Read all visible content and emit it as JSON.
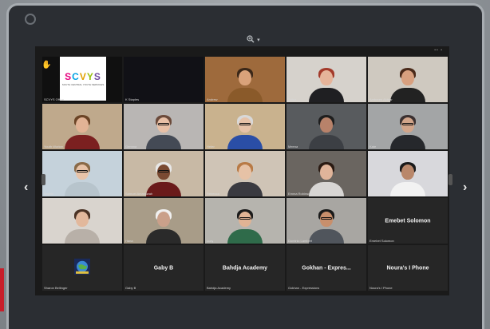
{
  "zoom": {
    "icon": "zoom-in-icon",
    "caret": "▾"
  },
  "window": {
    "top_meta": "▪▪ ▪"
  },
  "tiles": [
    {
      "type": "logo",
      "logo_text": "SCVYS",
      "logo_sub": "SOUTH CENTRAL YOUTH SERVICES",
      "letter_colors": [
        "#e6007e",
        "#00a0e3",
        "#e2a100",
        "#97bf0d",
        "#6f4a9e"
      ],
      "caption": "SCVYS Office"
    },
    {
      "type": "video",
      "bg": "#111116",
      "caption": "K Staples"
    },
    {
      "type": "video",
      "bg": "#9e6a3c",
      "skin": "#d9a27a",
      "hair": "#3a2718",
      "shirt": "#8a5a2a",
      "caption": "Andrew"
    },
    {
      "type": "video",
      "bg": "#d6d2cc",
      "skin": "#e6b49a",
      "hair": "#a33a2a",
      "shirt": "#1f1f22",
      "caption": "Zehra"
    },
    {
      "type": "video",
      "bg": "#cfc9c0",
      "skin": "#d8a07f",
      "hair": "#4a2a1a",
      "shirt": "#222222",
      "caption": "Ambreen Akhtar"
    },
    {
      "type": "video",
      "bg": "#bfa98c",
      "skin": "#e2b395",
      "hair": "#6b4426",
      "shirt": "#7b2020",
      "caption": "Youth Worker"
    },
    {
      "type": "video",
      "bg": "#b9b6b4",
      "skin": "#e8c0a6",
      "hair": "#6b4a3a",
      "shirt": "#444a55",
      "glasses": true,
      "caption": "Gemma"
    },
    {
      "type": "video",
      "bg": "#c9b28e",
      "skin": "#e6c2a8",
      "hair": "#d8d8d8",
      "shirt": "#2a4ea6",
      "glasses": true,
      "caption": "Helen"
    },
    {
      "type": "video",
      "bg": "#585b5e",
      "skin": "#b8826a",
      "hair": "#1e1e1e",
      "shirt": "#3c3f44",
      "caption": "Meena"
    },
    {
      "type": "video",
      "bg": "#a3a5a6",
      "skin": "#d2a58a",
      "hair": "#3a3030",
      "shirt": "#26282c",
      "glasses": true,
      "caption": "Kate"
    },
    {
      "type": "video",
      "bg": "#c5d2db",
      "skin": "#e8c3a8",
      "hair": "#8a6a48",
      "shirt": "#b7c4cc",
      "glasses": true,
      "caption": "Sophie"
    },
    {
      "type": "video",
      "bg": "#c8b9a5",
      "skin": "#7a4a32",
      "hair": "#e8e8e8",
      "shirt": "#6a1a1a",
      "glasses": true,
      "caption": "Samuel Amankwah"
    },
    {
      "type": "video",
      "bg": "#cfc4b6",
      "skin": "#e6c2a6",
      "hair": "#b87a45",
      "shirt": "#3a3a40",
      "caption": "Rebecca"
    },
    {
      "type": "video",
      "bg": "#6a6560",
      "skin": "#e0b49a",
      "hair": "#2a1a12",
      "shirt": "#d8d6d4",
      "caption": "Emma Robinson"
    },
    {
      "type": "video",
      "bg": "#d8d8dc",
      "skin": "#b9876a",
      "hair": "#1a1a1a",
      "shirt": "#f2f2f2",
      "caption": "Tom Hardy"
    },
    {
      "type": "video",
      "bg": "#d9d4ce",
      "skin": "#e2b89c",
      "hair": "#4a3224",
      "shirt": "#b8b0a8",
      "caption": "Claire"
    },
    {
      "type": "video",
      "bg": "#a89c88",
      "skin": "#caa08a",
      "hair": "#f0f0f0",
      "shirt": "#2a2a2a",
      "caption": "Hana"
    },
    {
      "type": "video",
      "bg": "#b6b4ae",
      "skin": "#e0b394",
      "hair": "#1a1a1a",
      "shirt": "#2f6b4a",
      "glasses": true,
      "caption": "Lucy"
    },
    {
      "type": "video",
      "bg": "#a8a6a2",
      "skin": "#c88f6c",
      "hair": "#1a1a1a",
      "shirt": "#50555c",
      "glasses": true,
      "caption": "Dominic Lambert"
    },
    {
      "type": "name",
      "name": "Emebet Solomon",
      "caption": "Emebet Solomon"
    },
    {
      "type": "emblem",
      "caption": "Sharon Bellinger"
    },
    {
      "type": "name",
      "name": "Gaby B",
      "caption": "Gaby B"
    },
    {
      "type": "name",
      "name": "Bahdja Academy",
      "caption": "Bahdja Academy"
    },
    {
      "type": "name",
      "name": "Gokhan - Expres...",
      "caption": "Gokhan - Expressions"
    },
    {
      "type": "name",
      "name": "Noura's I Phone",
      "caption": "Noura's I Phone"
    }
  ],
  "nav": {
    "prev": "‹",
    "next": "›"
  }
}
